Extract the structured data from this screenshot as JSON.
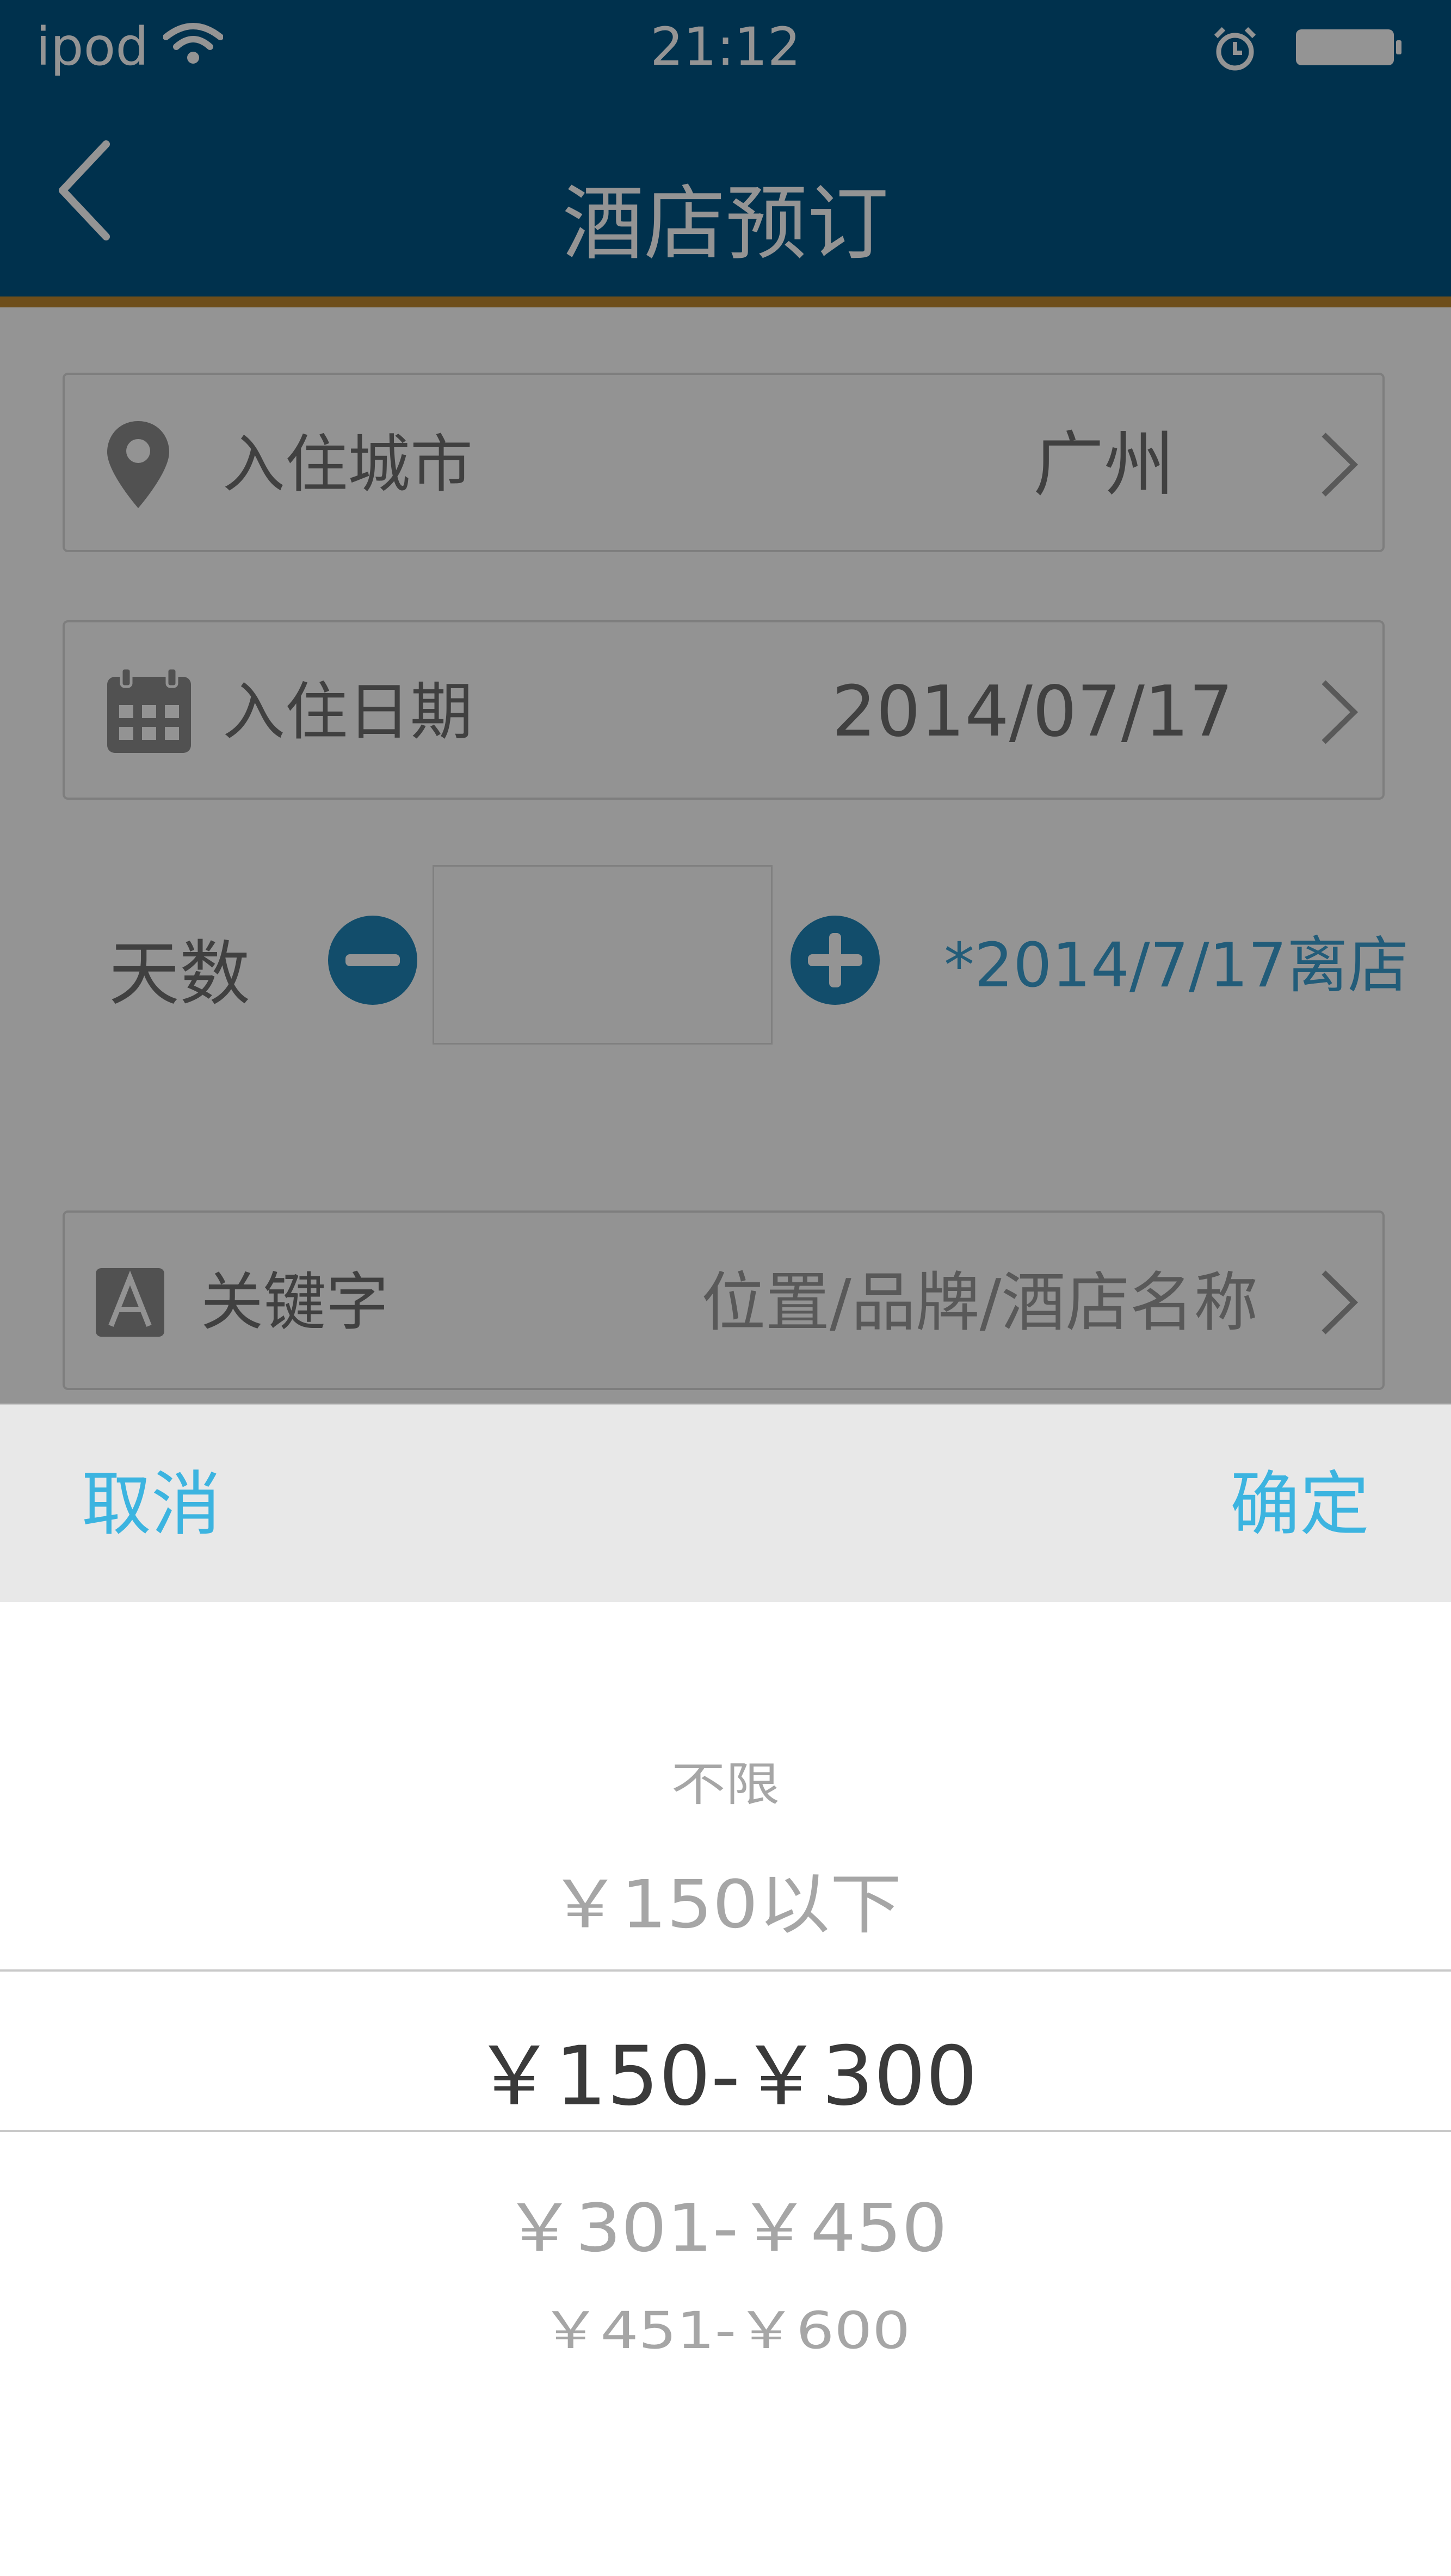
{
  "status_bar": {
    "carrier": "ipod",
    "time": "21:12",
    "wifi_icon": "wifi-icon",
    "alarm_icon": "alarm-icon",
    "battery_icon": "battery-icon"
  },
  "navbar": {
    "title": "酒店预订",
    "back_icon": "chevron-left-icon"
  },
  "form": {
    "city": {
      "label": "入住城市",
      "value": "广州",
      "icon": "location-pin-icon"
    },
    "date": {
      "label": "入住日期",
      "value": "2014/07/17",
      "icon": "calendar-icon"
    },
    "days": {
      "label": "天数",
      "value": "",
      "checkout_note": "*2014/7/17离店"
    },
    "keyword": {
      "label": "关键字",
      "placeholder": "位置/品牌/酒店名称",
      "icon": "letter-a-icon"
    }
  },
  "sheet": {
    "cancel_label": "取消",
    "confirm_label": "确定"
  },
  "price_picker": {
    "options": [
      "不限",
      "￥150以下",
      "￥150-￥300",
      "￥301-￥450",
      "￥451-￥600"
    ],
    "selected": "￥150-￥300"
  },
  "colors": {
    "header": "#005586",
    "accent_line": "#bd872d",
    "action": "#3cb4e0",
    "stepper": "#1f86b8"
  }
}
